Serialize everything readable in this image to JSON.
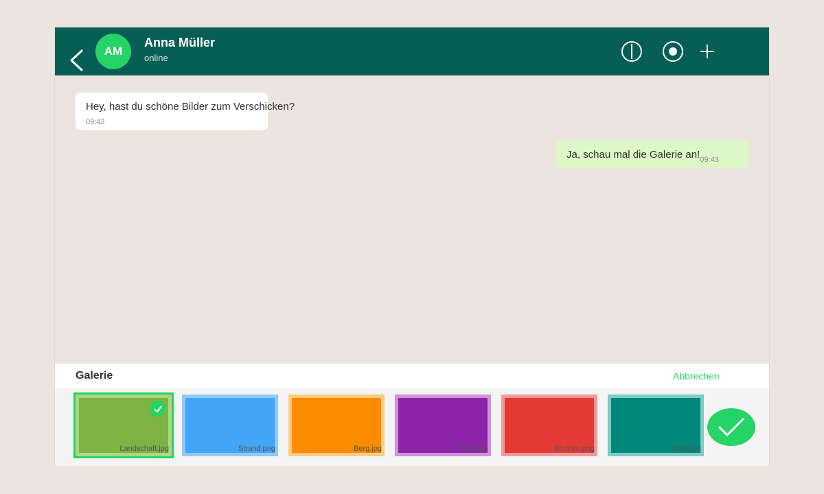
{
  "header": {
    "avatar_initials": "AM",
    "contact_name": "Anna Müller",
    "status": "online",
    "icons": [
      "back-arrow-icon",
      "info-icon",
      "record-icon",
      "plus-icon"
    ]
  },
  "messages": [
    {
      "direction": "incoming",
      "text": "Hey, hast du schöne Bilder zum Verschicken?",
      "time": "09:42"
    },
    {
      "direction": "outgoing",
      "text": "Ja, schau mal die Galerie an!",
      "time": "09:43"
    }
  ],
  "gallery": {
    "title": "Galerie",
    "cancel_label": "Abbrechen",
    "items": [
      {
        "name": "Landschaft.jpg",
        "color": "#7cb342",
        "border": "#aed581",
        "selected": true
      },
      {
        "name": "Strand.png",
        "color": "#42a5f5",
        "border": "#90caf9",
        "selected": false
      },
      {
        "name": "Berg.jpg",
        "color": "#fb8c00",
        "border": "#ffcc80",
        "selected": false
      },
      {
        "name": "Stadt.jpg",
        "color": "#8e24aa",
        "border": "#ce93d8",
        "selected": false
      },
      {
        "name": "Blumen.png",
        "color": "#e53935",
        "border": "#ef9a9a",
        "selected": false
      },
      {
        "name": "Wald.jpg",
        "color": "#00897b",
        "border": "#80cbc4",
        "selected": false
      }
    ]
  },
  "colors": {
    "header": "#075e54",
    "accent": "#25d366",
    "incoming_bubble": "#ffffff",
    "outgoing_bubble": "#dcf8c6",
    "background": "#ece5df"
  }
}
